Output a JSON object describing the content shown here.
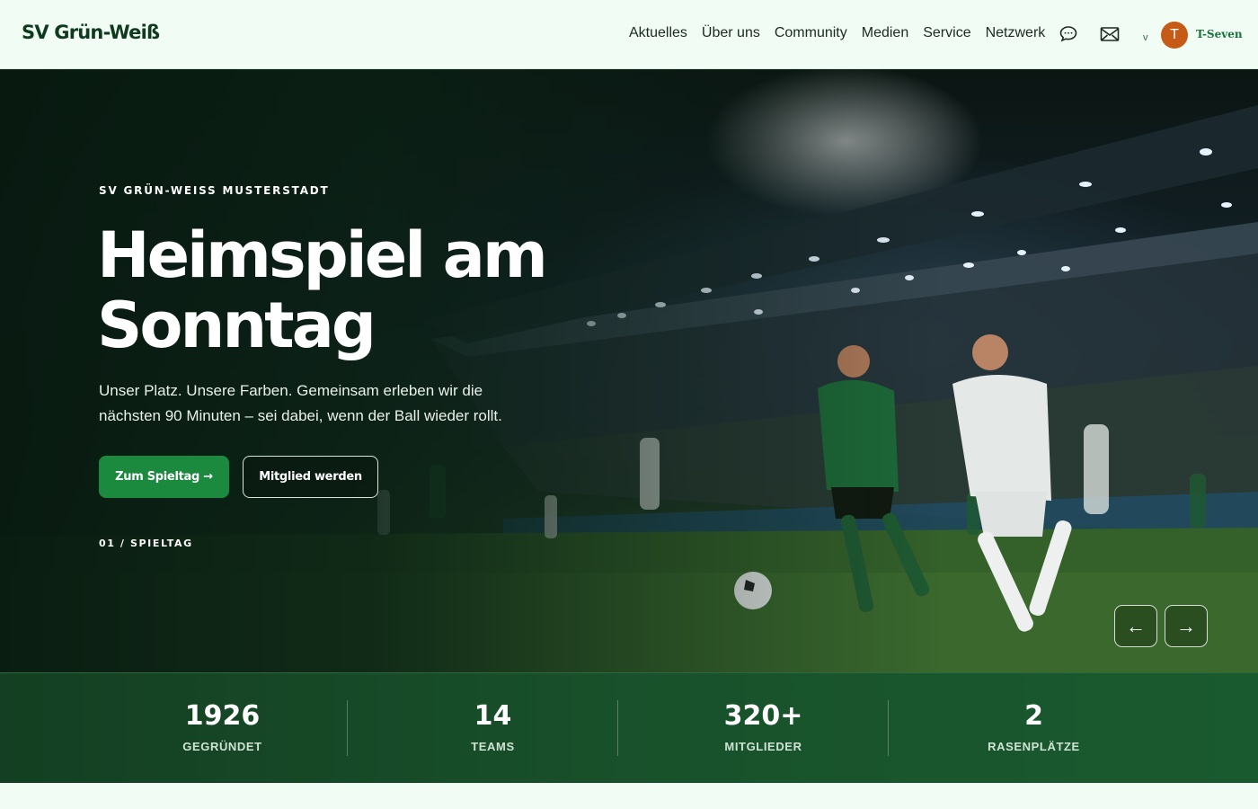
{
  "header": {
    "logo": "SV Grün-Weiß",
    "nav": [
      "Aktuelles",
      "Über uns",
      "Community",
      "Medien",
      "Service",
      "Netzwerk"
    ],
    "icons": [
      "chat-icon",
      "mail-icon"
    ],
    "dropdown": "v",
    "user": {
      "initial": "T",
      "name": "T-Seven",
      "avatar_color": "#c65a17"
    }
  },
  "hero": {
    "kicker": "SV GRÜN-WEISS MUSTERSTADT",
    "title": "Heimspiel am Sonntag",
    "text": "Unser Platz. Unsere Farben. Gemeinsam erleben wir die nächsten 90 Minuten – sei dabei, wenn der Ball wieder rollt.",
    "primary_button": "Zum Spieltag →",
    "secondary_button": "Mitglied werden",
    "slide_counter": "01 / SPIELTAG",
    "prev": "←",
    "next": "→"
  },
  "stats": [
    {
      "value": "1926",
      "label": "GEGRÜNDET"
    },
    {
      "value": "14",
      "label": "TEAMS"
    },
    {
      "value": "320+",
      "label": "MITGLIEDER"
    },
    {
      "value": "2",
      "label": "RASENPLÄTZE"
    }
  ],
  "colors": {
    "accent": "#1b8a3f",
    "brand_dark": "#0f3a1f",
    "stats_bg": "#18512b",
    "page_bg": "#f1fcf4"
  }
}
